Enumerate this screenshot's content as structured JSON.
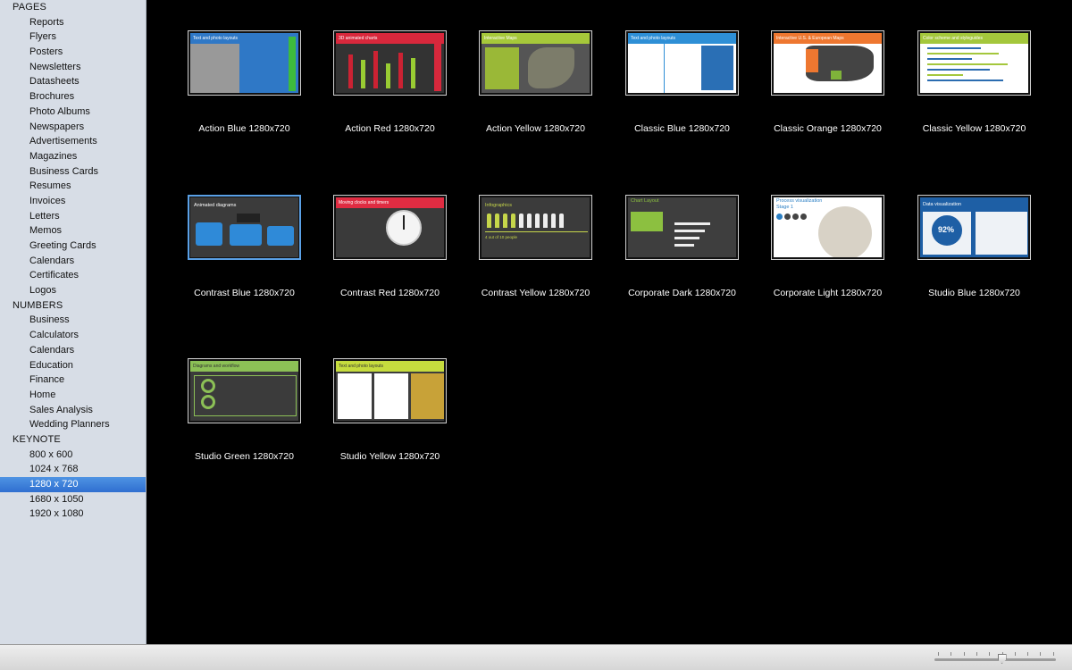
{
  "sidebar": {
    "sections": [
      {
        "title": "PAGES",
        "items": [
          "Reports",
          "Flyers",
          "Posters",
          "Newsletters",
          "Datasheets",
          "Brochures",
          "Photo Albums",
          "Newspapers",
          "Advertisements",
          "Magazines",
          "Business Cards",
          "Resumes",
          "Invoices",
          "Letters",
          "Memos",
          "Greeting Cards",
          "Calendars",
          "Certificates",
          "Logos"
        ]
      },
      {
        "title": "NUMBERS",
        "items": [
          "Business",
          "Calculators",
          "Calendars",
          "Education",
          "Finance",
          "Home",
          "Sales Analysis",
          "Wedding Planners"
        ]
      },
      {
        "title": "KEYNOTE",
        "items": [
          "800 x 600",
          "1024 x 768",
          "1280 x 720",
          "1680 x 1050",
          "1920 x 1080"
        ]
      }
    ],
    "selected_item": "1280 x 720"
  },
  "templates": [
    {
      "label": "Action Blue 1280x720",
      "thumb_title": "Text and photo layouts",
      "accent": "#2f78c6"
    },
    {
      "label": "Action Red 1280x720",
      "thumb_title": "3D animated charts",
      "accent": "#d8283c"
    },
    {
      "label": "Action Yellow 1280x720",
      "thumb_title": "Interactive Maps",
      "accent": "#a6c83a"
    },
    {
      "label": "Classic Blue 1280x720",
      "thumb_title": "Text and photo layouts",
      "accent": "#2e8fd6"
    },
    {
      "label": "Classic Orange 1280x720",
      "thumb_title": "Interactive U.S. & European Maps",
      "accent": "#ee7730"
    },
    {
      "label": "Classic Yellow 1280x720",
      "thumb_title": "Color scheme and styleguides",
      "accent": "#a4c73c"
    },
    {
      "label": "Contrast Blue 1280x720",
      "thumb_title": "Animated diagrams",
      "accent": "#2f8ad8"
    },
    {
      "label": "Contrast Red 1280x720",
      "thumb_title": "Moving clocks and timers",
      "accent": "#e02c42"
    },
    {
      "label": "Contrast Yellow 1280x720",
      "thumb_title": "Infographics",
      "accent": "#c6d64a"
    },
    {
      "label": "Corporate Dark 1280x720",
      "thumb_title": "Chart Layout",
      "accent": "#8cc040"
    },
    {
      "label": "Corporate Light 1280x720",
      "thumb_title": "Process visualization",
      "accent": "#2b7fc4"
    },
    {
      "label": "Studio Blue 1280x720",
      "thumb_title": "Data visualization",
      "accent": "#1e5fa5",
      "thumb_value": "92%"
    },
    {
      "label": "Studio Green 1280x720",
      "thumb_title": "Diagrams and workflow",
      "accent": "#8cc056"
    },
    {
      "label": "Studio Yellow 1280x720",
      "thumb_title": "Text and photo layouts",
      "accent": "#c6dc3e"
    }
  ],
  "thumb_texts": {
    "corp_light_stage": "Stage 1",
    "contrast_yellow_caption": "4 out of 10 people"
  },
  "zoom": {
    "level": 0.56
  }
}
